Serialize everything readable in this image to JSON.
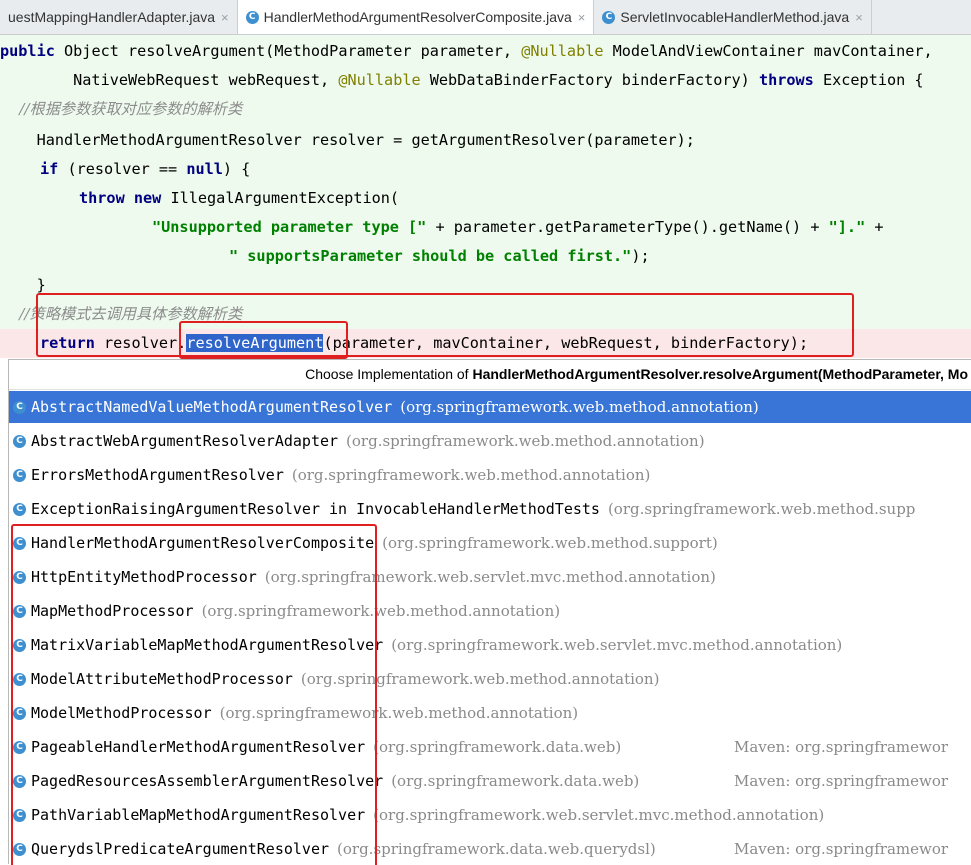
{
  "tabs": [
    {
      "label": "uestMappingHandlerAdapter.java",
      "close": "×",
      "active": false
    },
    {
      "label": "HandlerMethodArgumentResolverComposite.java",
      "close": "×",
      "active": true
    },
    {
      "label": "ServletInvocableHandlerMethod.java",
      "close": "×",
      "active": false
    }
  ],
  "code": {
    "line1": {
      "kw": "public",
      "t1": " Object resolveArgument(MethodParameter parameter, ",
      "ann1": "@Nullable",
      "t2": " ModelAndViewContainer mavContainer,"
    },
    "line2": {
      "t1": "        NativeWebRequest webRequest, ",
      "ann1": "@Nullable",
      "t2": " WebDataBinderFactory binderFactory) ",
      "kw": "throws",
      "t3": " Exception {"
    },
    "line3": {
      "cmt": "    //根据参数获取对应参数的解析类"
    },
    "line4": {
      "t1": "    HandlerMethodArgumentResolver resolver = getArgumentResolver(parameter);"
    },
    "line5": {
      "kw1": "if",
      "t1": " (resolver == ",
      "kw2": "null",
      "t2": ") {"
    },
    "line6": {
      "kw1": "throw",
      "kw2": "new",
      "t1": " IllegalArgumentException("
    },
    "line7": {
      "str1": "\"Unsupported parameter type [\"",
      "t1": " + parameter.getParameterType().getName() + ",
      "str2": "\"].\"",
      "t2": " +"
    },
    "line8": {
      "str1": "\" supportsParameter should be called first.\"",
      "t1": ");"
    },
    "line9": {
      "t1": "    }"
    },
    "line10": {
      "cmt": "    //策略模式去调用具体参数解析类"
    },
    "line11": {
      "kw": "return",
      "t1": " resolver.",
      "hl": "resolveArgument",
      "t2": "(parameter, mavContainer, webRequest, binderFactory);"
    }
  },
  "popup": {
    "title_prefix": "Choose Implementation of ",
    "title_bold": "HandlerMethodArgumentResolver.resolveArgument(MethodParameter, Mo",
    "icon_letter": "C",
    "items": [
      {
        "name": "AbstractNamedValueMethodArgumentResolver",
        "pkg": "(org.springframework.web.method.annotation)",
        "maven": "",
        "selected": true
      },
      {
        "name": "AbstractWebArgumentResolverAdapter",
        "pkg": "(org.springframework.web.method.annotation)",
        "maven": "",
        "selected": false
      },
      {
        "name": "ErrorsMethodArgumentResolver",
        "pkg": "(org.springframework.web.method.annotation)",
        "maven": "",
        "selected": false
      },
      {
        "name": "ExceptionRaisingArgumentResolver in InvocableHandlerMethodTests",
        "pkg": "(org.springframework.web.method.supp",
        "maven": "",
        "selected": false
      },
      {
        "name": "HandlerMethodArgumentResolverComposite",
        "pkg": "(org.springframework.web.method.support)",
        "maven": "",
        "selected": false
      },
      {
        "name": "HttpEntityMethodProcessor",
        "pkg": "(org.springframework.web.servlet.mvc.method.annotation)",
        "maven": "",
        "selected": false
      },
      {
        "name": "MapMethodProcessor",
        "pkg": "(org.springframework.web.method.annotation)",
        "maven": "",
        "selected": false
      },
      {
        "name": "MatrixVariableMapMethodArgumentResolver",
        "pkg": "(org.springframework.web.servlet.mvc.method.annotation)",
        "maven": "",
        "selected": false
      },
      {
        "name": "ModelAttributeMethodProcessor",
        "pkg": "(org.springframework.web.method.annotation)",
        "maven": "",
        "selected": false
      },
      {
        "name": "ModelMethodProcessor",
        "pkg": "(org.springframework.web.method.annotation)",
        "maven": "",
        "selected": false
      },
      {
        "name": "PageableHandlerMethodArgumentResolver",
        "pkg": "(org.springframework.data.web)",
        "maven": "Maven: org.springframewor",
        "selected": false
      },
      {
        "name": "PagedResourcesAssemblerArgumentResolver",
        "pkg": "(org.springframework.data.web)",
        "maven": "Maven: org.springframewor",
        "selected": false
      },
      {
        "name": "PathVariableMapMethodArgumentResolver",
        "pkg": "(org.springframework.web.servlet.mvc.method.annotation)",
        "maven": "",
        "selected": false
      },
      {
        "name": "QuerydslPredicateArgumentResolver",
        "pkg": "(org.springframework.data.web.querydsl)",
        "maven": "Maven: org.springframewor",
        "selected": false
      }
    ]
  },
  "colors": {
    "selection": "#3875d6",
    "highlight": "#2f65ca",
    "editor_bg": "#eefaee",
    "annotation_box": "#e02020"
  }
}
